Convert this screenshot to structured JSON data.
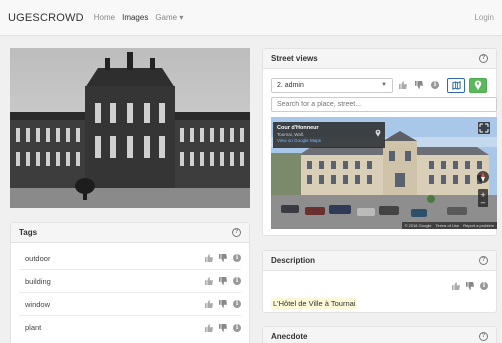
{
  "navbar": {
    "brand": "UGESCROWD",
    "links": [
      "Home",
      "Images",
      "Game ▾"
    ],
    "login": "Login"
  },
  "tags": {
    "title": "Tags",
    "items": [
      "outdoor",
      "building",
      "window",
      "plant"
    ]
  },
  "street_views": {
    "title": "Street views",
    "selected": "2. admin",
    "search_placeholder": "Search for a place, street...",
    "card_title": "Cour d'Honneur",
    "card_subtitle": "Tournai, Wall.",
    "card_link": "View on Google Maps",
    "footer": [
      "© 2018 Google",
      "Terms of Use",
      "Report a problem"
    ]
  },
  "description": {
    "title": "Description",
    "text": "L'Hôtel de Ville à Tournai"
  },
  "anecdote": {
    "title": "Anecdote"
  },
  "colors": {
    "primary": "#2e6da4",
    "success": "#5cb85c"
  }
}
